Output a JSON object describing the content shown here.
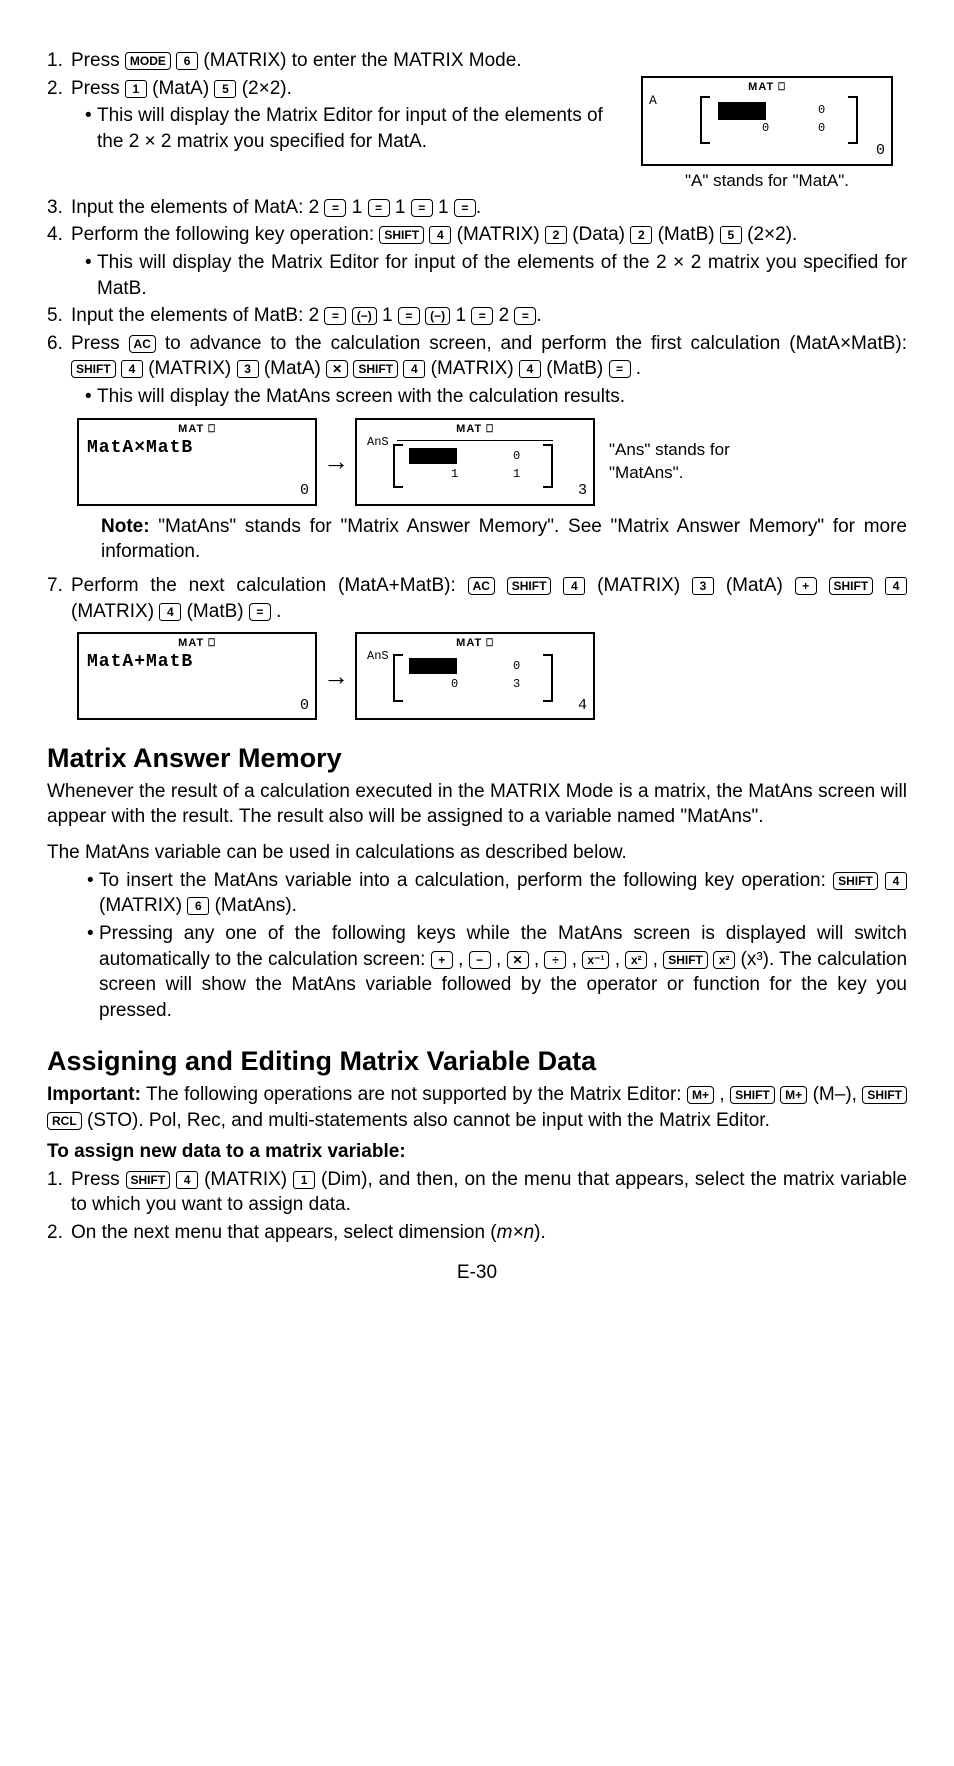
{
  "k": {
    "mode": "MODE",
    "shift": "SHIFT",
    "ac": "AC",
    "mplus": "M+",
    "rcl": "RCL",
    "eq": "=",
    "neg": "(−)",
    "plus": "+",
    "minus": "−",
    "mul": "✕",
    "div": "÷",
    "xinv": "x⁻¹",
    "x2": "x²"
  },
  "step1": {
    "pre": "1.",
    "a": "Press ",
    "b": "6",
    "c": "(MATRIX) to enter the MATRIX Mode."
  },
  "step2": {
    "pre": "2.",
    "a": "Press ",
    "k1": "1",
    "lbl1": "(MatA)",
    "k2": "5",
    "lbl2": "(2×2).",
    "bul": "This will display the Matrix Editor for input of the elements of the 2 × 2 matrix you specified for MatA."
  },
  "scr": {
    "hdr": "MAT ⎕",
    "A": "A",
    "br0": "0",
    "br3": "3",
    "br4": "4",
    "Ans": "AnS",
    "c01": "0",
    "c02": "0",
    "c03": "0",
    "c04": "1",
    "cap1": "\"A\" stands for \"MatA\"."
  },
  "step3": {
    "pre": "3.",
    "a": "Input the elements of MatA: 2 ",
    "mid": " 1 ",
    "end": "."
  },
  "step4": {
    "pre": "4.",
    "a": "Perform the following key operation: ",
    "k4": "4",
    "lbl4": "(MATRIX)",
    "k2": "2",
    "lbl2": "(Data) ",
    "k2b": "2",
    "lbl2b": "(MatB)",
    "k5": "5",
    "lbl5": "(2×2).",
    "bul": "This will display the Matrix Editor for input of the elements of the 2 × 2 matrix you specified for MatB."
  },
  "step5": {
    "pre": "5.",
    "a": "Input the elements of MatB: 2 ",
    "mid": " 1 ",
    "end": " 2 ",
    "fin": "."
  },
  "step6": {
    "pre": "6.",
    "a": "Press ",
    "b": " to advance to the calculation screen, and perform the first calculation (MatA×MatB): ",
    "k4": "4",
    "lbl4": "(MATRIX)",
    "k3": "3",
    "lbl3": "(MatA)",
    "k4b": "4",
    "lbl4b": "(MATRIX) ",
    "k4c": "4",
    "lbl4c": "(MatB)",
    "bul": "This will display the MatAns screen with the calculation results."
  },
  "expr1": "MatA×MatB",
  "expr2": "MatA+MatB",
  "anscap": "\"Ans\" stands for \"MatAns\".",
  "note": {
    "b": "Note:",
    "t": " \"MatAns\" stands for \"Matrix Answer Memory\". See \"Matrix Answer Memory\" for more information."
  },
  "step7": {
    "pre": "7.",
    "a": "Perform the next calculation (MatA+MatB): ",
    "k4": "4",
    "lbl4": "(MATRIX) ",
    "k3": "3",
    "lbl3": "(MatA)",
    "k4b": "4",
    "lbl4b": "(MATRIX)",
    "k4c": "4",
    "lbl4c": "(MatB)"
  },
  "mam": {
    "h": "Matrix Answer Memory",
    "p1": "Whenever the result of a calculation executed in the MATRIX Mode is a matrix, the MatAns screen will appear with the result. The result also will be assigned to a variable named \"MatAns\".",
    "p2": "The MatAns variable can be used in calculations as described below.",
    "b1a": "To insert the MatAns variable into a calculation, perform the following key operation: ",
    "b1k4": "4",
    "b1lbl4": "(MATRIX)",
    "b1k6": "6",
    "b1lbl6": "(MatAns).",
    "b2a": "Pressing any one of the following keys while the MatAns screen is displayed will switch automatically to the calculation screen: ",
    "b2mid": ", ",
    "b2x3": "(x³). The calculation screen will show the MatAns variable followed by the operator or function for the key you pressed."
  },
  "aem": {
    "h": "Assigning and Editing Matrix Variable Data",
    "imp": "Important:",
    "t1": " The following operations are not supported by the Matrix Editor: ",
    "mm": "(M–), ",
    "sto": "(STO). Pol, Rec, and multi-statements also cannot be input with the Matrix Editor.",
    "sub": "To assign new data to a matrix variable:",
    "s1pre": "1.",
    "s1a": "Press ",
    "s1k4": "4",
    "s1lbl4": "(MATRIX)",
    "s1k1": "1",
    "s1lbl1": "(Dim), and then, on the menu that appears, select the matrix variable to which you want to assign data.",
    "s2pre": "2.",
    "s2": "On the next menu that appears, select dimension (",
    "mn": "m×n",
    "s2end": ")."
  },
  "pg": "E-30"
}
